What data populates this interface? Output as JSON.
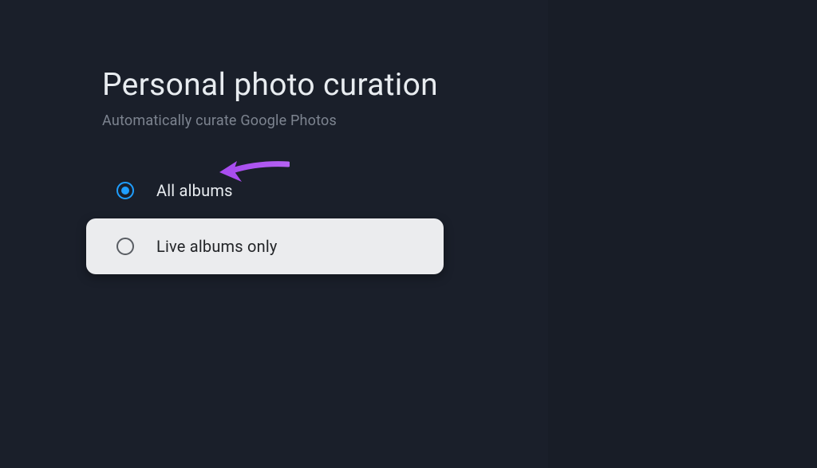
{
  "header": {
    "title": "Personal photo curation",
    "subtitle": "Automatically curate Google Photos"
  },
  "options": {
    "item0": {
      "label": "All albums"
    },
    "item1": {
      "label": "Live albums only"
    }
  },
  "annotation": {
    "arrow_color": "#a84df0"
  }
}
